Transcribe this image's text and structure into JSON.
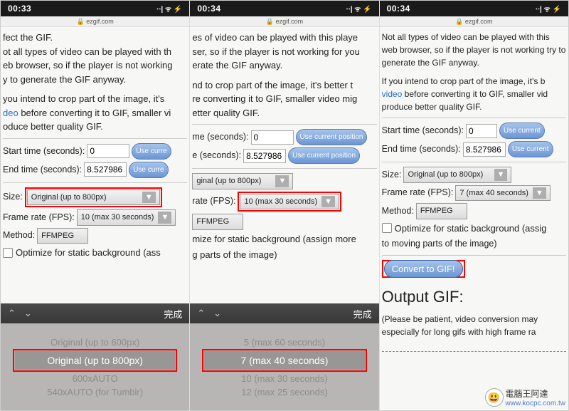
{
  "status": {
    "time1": "00:33",
    "time2": "00:34",
    "time3": "00:34",
    "signal": "⋅⋅| ᯤ ⚡"
  },
  "url": "ezgif.com",
  "panel1": {
    "p1a": "fect the GIF.",
    "p1b": "ot all types of video can be played with th",
    "p1c": "eb browser, so if the player is not working",
    "p1d": "y to generate the GIF anyway.",
    "p2a": "you intend to crop part of the image, it's",
    "p2b": " before converting it to GIF, smaller vi",
    "p2c": "oduce better quality GIF.",
    "link": "deo",
    "start_label": "Start time (seconds):",
    "start_val": "0",
    "btn_pos": "Use curre",
    "end_label": "End time (seconds):",
    "end_val": "8.527986",
    "btn_pos2": "Use curre",
    "size_label": "Size:",
    "size_val": "Original (up to 800px)",
    "fps_label": "Frame rate (FPS):",
    "fps_val": "10 (max 30 seconds)",
    "method_label": "Method:",
    "method_val": "FFMPEG",
    "opt_label": "Optimize for static background (ass",
    "picker_done": "完成",
    "picker_opts": [
      "Original (up to 600px)",
      "Original (up to 800px)",
      "600xAUTO",
      "540xAUTO (for Tumblr)"
    ]
  },
  "panel2": {
    "p1a": "es of video can be played with this playe",
    "p1b": "ser, so if the player is not working for you",
    "p1c": "erate the GIF anyway.",
    "p2a": "nd to crop part of the image, it's better t",
    "p2b": "re converting it to GIF, smaller video mig",
    "p2c": "etter quality GIF.",
    "start_label": "me (seconds):",
    "start_val": "0",
    "btn_pos": "Use current position",
    "end_label": "e (seconds):",
    "end_val": "8.527986",
    "btn_pos2": "Use current position",
    "size_val": "ginal (up to 800px)",
    "fps_label": "rate (FPS):",
    "fps_val": "10 (max 30 seconds)",
    "method_val": "FFMPEG",
    "opt1": "mize for static background (assign more",
    "opt2": "g parts of the image)",
    "picker_opts": [
      "5 (max 60 seconds)",
      "7 (max 40 seconds)",
      "10 (max 30 seconds)",
      "12 (max 25 seconds)"
    ]
  },
  "panel3": {
    "p1": "Not all types of video can be played with this web browser, so if the player is not working try to generate the GIF anyway.",
    "p2a": "If you intend to crop part of the image, it's b",
    "p2b": " before converting it to GIF, smaller vid produce better quality GIF.",
    "link": "video",
    "start_label": "Start time (seconds):",
    "start_val": "0",
    "btn1": "Use current",
    "end_label": "End time (seconds):",
    "end_val": "8.527986",
    "btn2": "Use current",
    "size_label": "Size:",
    "size_val": "Original (up to 800px)",
    "fps_label": "Frame rate (FPS):",
    "fps_val": "7 (max 40 seconds)",
    "method_label": "Method:",
    "method_val": "FFMPEG",
    "opt1": "Optimize for static background (assig",
    "opt2": "to moving parts of the image)",
    "convert": "Convert to GIF!",
    "output_h": "Output GIF:",
    "output_p": "(Please be patient, video conversion may especially for long gifs with high frame ra"
  },
  "watermark": {
    "text1": "電腦王阿達",
    "text2": "www.kocpc.com.tw"
  }
}
